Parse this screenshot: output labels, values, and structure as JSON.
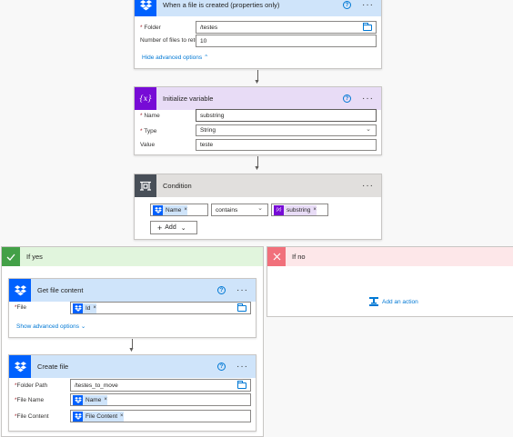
{
  "colors": {
    "dropbox_blue": "#0061fe",
    "trigger_header": "#cfe4fa",
    "variable_tile": "#770bd6",
    "variable_header": "#e8dcf6",
    "condition_tile": "#484f58",
    "condition_header": "#e1dfdd",
    "yes_header": "#e1f5dd",
    "yes_tile": "#43a047",
    "no_header": "#fde7e9",
    "no_tile": "#f1707b",
    "link": "#0078d4"
  },
  "trigger": {
    "title": "When a file is created (properties only)",
    "icon": "dropbox-icon",
    "folder_label": "Folder",
    "folder_value": "/testes",
    "count_label": "Number of files to return",
    "count_value": "10",
    "advanced_link": "Hide advanced options"
  },
  "variable": {
    "title": "Initialize variable",
    "icon": "variable-icon",
    "icon_text": "{x}",
    "name_label": "Name",
    "name_value": "substring",
    "type_label": "Type",
    "type_value": "String",
    "value_label": "Value",
    "value_value": "teste"
  },
  "condition": {
    "title": "Condition",
    "icon": "condition-icon",
    "left_token": "Name",
    "operator": "contains",
    "right_token": "substring",
    "right_icon_text": "{x}",
    "add_label": "Add"
  },
  "if_yes": {
    "title": "If yes",
    "get_file": {
      "title": "Get file content",
      "file_label": "File",
      "file_token": "Id",
      "advanced_link": "Show advanced options"
    },
    "create_file": {
      "title": "Create file",
      "folder_label": "Folder Path",
      "folder_value": "/testes_to_move",
      "name_label": "File Name",
      "name_token": "Name",
      "content_label": "File Content",
      "content_token": "File Content"
    }
  },
  "if_no": {
    "title": "If no",
    "add_action": "Add an action"
  },
  "help_glyph": "?",
  "more_glyph": "···",
  "remove_glyph": "×",
  "required_glyph": "*",
  "dropdown_glyph": "⌄",
  "plus_glyph": "+",
  "up_chevron": "⌃",
  "down_chevron": "⌄",
  "arrow_glyph": "▼"
}
